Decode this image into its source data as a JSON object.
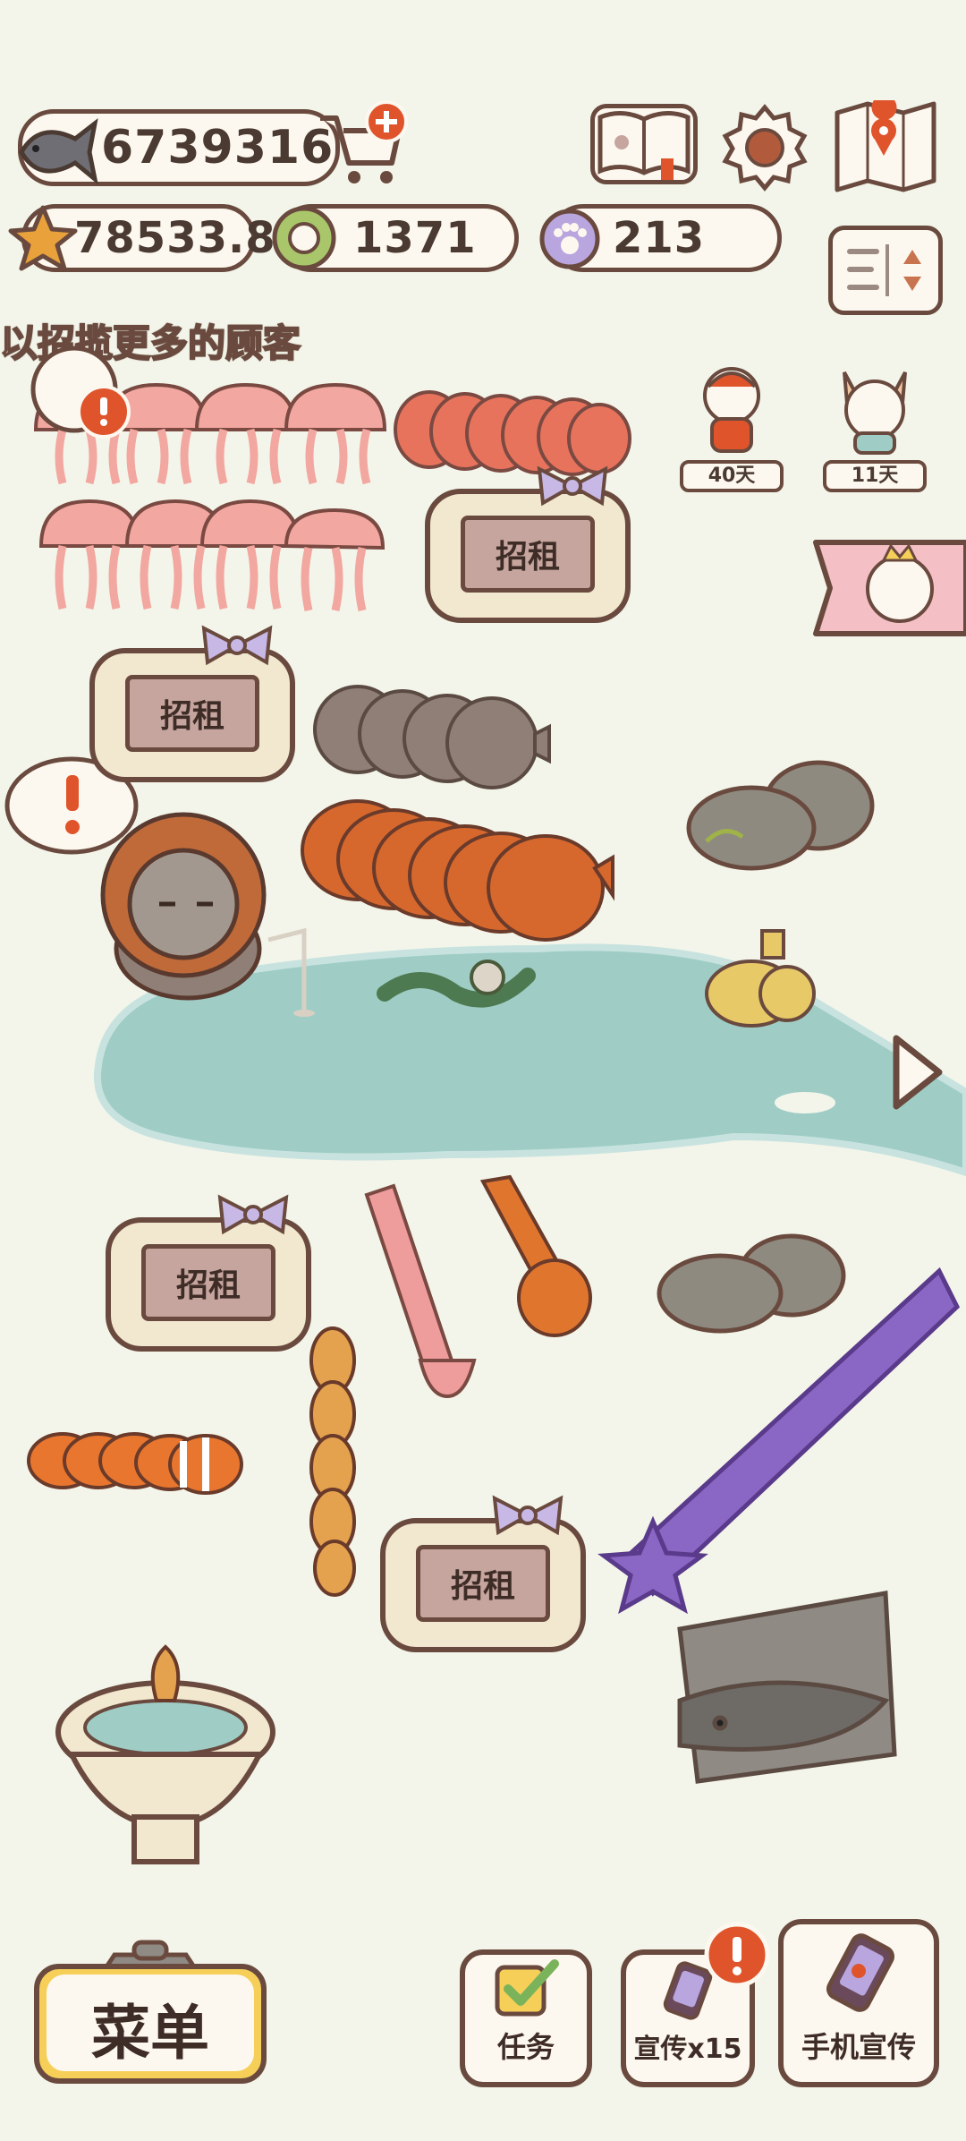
{
  "currency": {
    "fish": "6739316",
    "star": "78533.8",
    "shell": "1371",
    "paw": "213"
  },
  "notice": "以招揽更多的顾客",
  "visitors": [
    {
      "days": "40天"
    },
    {
      "days": "11天"
    }
  ],
  "rent_signs": [
    "招租",
    "招租",
    "招租",
    "招租"
  ],
  "bottom": {
    "menu_label": "菜单",
    "tasks_label": "任务",
    "promo_label": "宣传x15",
    "phone_promo_label": "手机宣传"
  },
  "icons": {
    "fish": "fish-icon",
    "cart": "cart-add-icon",
    "book": "book-icon",
    "settings": "gear-icon",
    "map": "map-icon",
    "star": "starfish-icon",
    "shell": "shell-icon",
    "paw": "paw-icon",
    "sort": "sort-icon"
  },
  "colors": {
    "border": "#6a4a3e",
    "pill_bg": "#fdf8ef",
    "pond": "#9fcdc6",
    "alert": "#e0542c",
    "menu_yellow": "#f5cf58"
  }
}
